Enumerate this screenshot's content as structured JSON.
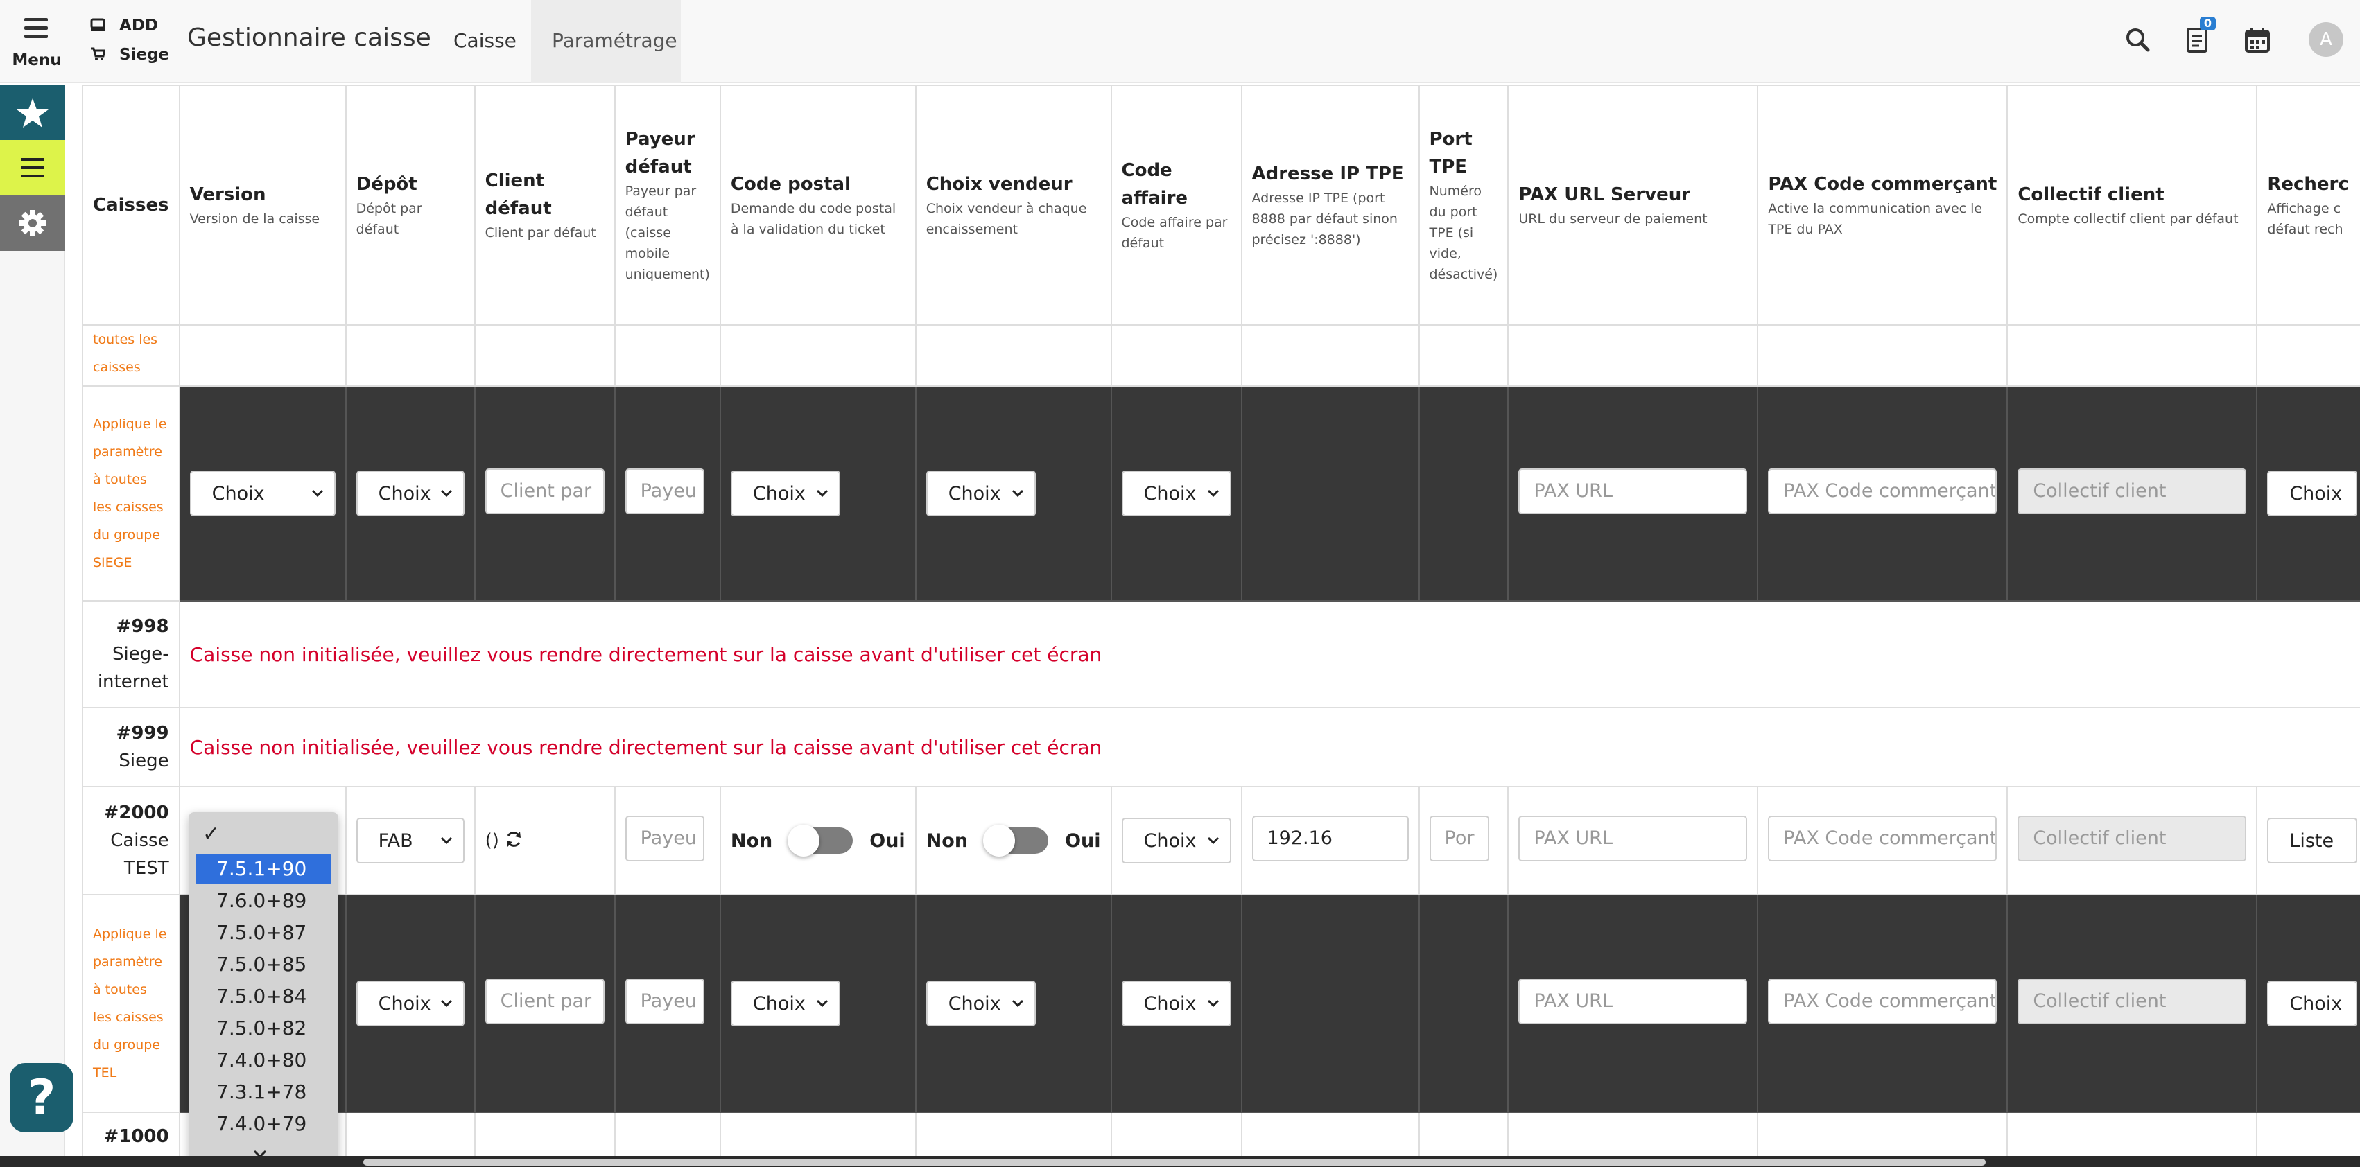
{
  "header": {
    "menu_label": "Menu",
    "ctx_add": "ADD",
    "ctx_siege": "Siege",
    "title": "Gestionnaire caisse",
    "tabs": [
      "Caisse",
      "Paramétrage"
    ],
    "active_tab": "Paramétrage",
    "notif_count": "0",
    "avatar_initial": "A"
  },
  "columns": [
    {
      "title": "Caisses",
      "sub": ""
    },
    {
      "title": "Version",
      "sub": "Version de la caisse"
    },
    {
      "title": "Dépôt",
      "sub": "Dépôt par défaut"
    },
    {
      "title": "Client défaut",
      "sub": "Client par défaut"
    },
    {
      "title": "Payeur défaut",
      "sub": "Payeur par défaut (caisse mobile uniquement)"
    },
    {
      "title": "Code postal",
      "sub": "Demande du code postal à la validation du ticket"
    },
    {
      "title": "Choix vendeur",
      "sub": "Choix vendeur à chaque encaissement"
    },
    {
      "title": "Code affaire",
      "sub": "Code affaire par défaut"
    },
    {
      "title": "Adresse IP TPE",
      "sub": "Adresse IP TPE (port 8888 par défaut sinon précisez ':8888')"
    },
    {
      "title": "Port TPE",
      "sub": "Numéro du port TPE (si vide, désactivé)"
    },
    {
      "title": "PAX URL Serveur",
      "sub": "URL du serveur de paiement"
    },
    {
      "title": "PAX Code commerçant",
      "sub": "Active la communication avec le TPE du PAX"
    },
    {
      "title": "Collectif client",
      "sub": "Compte collectif client par défaut"
    },
    {
      "title": "Recherc",
      "sub": "Affichage c défaut rech"
    }
  ],
  "rows": {
    "partial_label": "toutes les caisses",
    "apply_siege": "Applique le paramètre à toutes les caisses du groupe SIEGE",
    "apply_tel": "Applique le paramètre à toutes les caisses du groupe TEL",
    "error_msg": "Caisse non initialisée, veuillez vous rendre directement sur la caisse avant d'utiliser cet écran",
    "caisse_998_num": "#998",
    "caisse_998_name": "Siege-internet",
    "caisse_999_num": "#999",
    "caisse_999_name": "Siege",
    "caisse_2000_num": "#2000",
    "caisse_2000_name": "Caisse TEST",
    "caisse_1000_num": "#1000"
  },
  "controls": {
    "choix": "Choix",
    "client_ph": "Client par",
    "payeur_ph": "Payeu",
    "pax_url_ph": "PAX URL",
    "pax_code_ph": "PAX Code commerçant",
    "collectif_ph": "Collectif client",
    "port_ph": "Por",
    "depot_2000": "FAB",
    "client_2000": "()",
    "ip_2000": "192.16",
    "liste": "Liste",
    "non": "Non",
    "oui": "Oui"
  },
  "dropdown": {
    "options": [
      "7.5.1+90",
      "7.6.0+89",
      "7.5.0+87",
      "7.5.0+85",
      "7.5.0+84",
      "7.5.0+82",
      "7.4.0+80",
      "7.3.1+78",
      "7.4.0+79"
    ],
    "highlighted": "7.5.1+90"
  }
}
